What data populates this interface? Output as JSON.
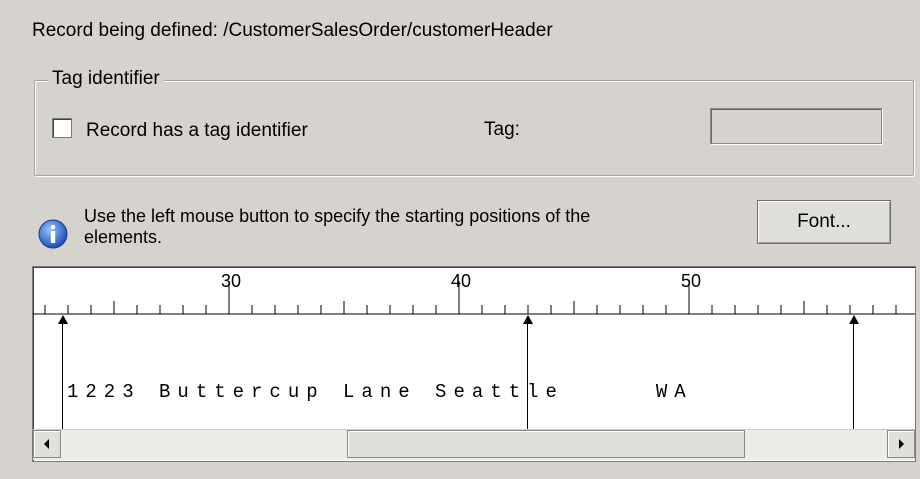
{
  "record": {
    "label": "Record being defined: /CustomerSalesOrder/customerHeader"
  },
  "tag_group": {
    "legend": "Tag identifier",
    "checkbox_label": "Record has a tag identifier",
    "checkbox_checked": false,
    "tag_label": "Tag:",
    "tag_value": ""
  },
  "info": {
    "icon": "info-icon",
    "line1": "Use the left mouse button to specify the starting positions of the",
    "line2": "elements."
  },
  "font_button": {
    "label": "Font..."
  },
  "ruler": {
    "labels": [
      "30",
      "40",
      "50"
    ]
  },
  "data_row": {
    "text": "1223 Buttercup Lane Seattle     WA"
  },
  "scrollbar": {
    "left_icon": "scroll-left-arrow-icon",
    "right_icon": "scroll-right-arrow-icon"
  }
}
